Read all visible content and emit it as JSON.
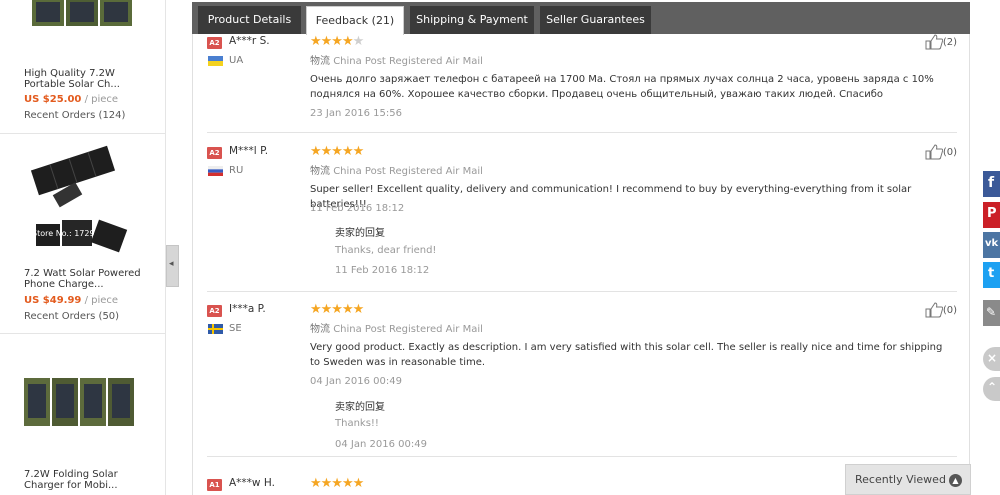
{
  "products": [
    {
      "title": "High Quality 7.2W Portable Solar Ch...",
      "price": "US $25.00",
      "unit": "/ piece",
      "orders": "Recent Orders (124)"
    },
    {
      "title": "7.2 Watt Solar Powered Phone Charge...",
      "price": "US $49.99",
      "unit": "/ piece",
      "orders": "Recent Orders (50)",
      "watermark": "Store No.: 1729"
    },
    {
      "title": "7.2W Folding Solar Charger for Mobi...",
      "price": "",
      "unit": "",
      "orders": ""
    }
  ],
  "tabs": [
    {
      "label": "Product Details",
      "active": false
    },
    {
      "label": "Feedback (21)",
      "active": true
    },
    {
      "label": "Shipping & Payment",
      "active": false
    },
    {
      "label": "Seller Guarantees",
      "active": false
    }
  ],
  "reviews": [
    {
      "badge": "A2",
      "badge_color": "#d9534f",
      "user": "A***r S.",
      "country": "UA",
      "flag": "ua",
      "rating": 4,
      "shipping_zh": "物流",
      "shipping": "China Post Registered Air Mail",
      "text": "Очень долго заряжает телефон с батареей на 1700 Ма. Стоял на прямых лучах солнца 2 часа, уровень заряда с 10% поднялся на 60%. Хорошее качество сборки. Продавец очень общительный, уважаю таких людей. Спасибо",
      "date": "23 Jan 2016 15:56",
      "likes": "(2)"
    },
    {
      "badge": "A2",
      "badge_color": "#d9534f",
      "user": "M***l P.",
      "country": "RU",
      "flag": "ru",
      "rating": 5,
      "shipping_zh": "物流",
      "shipping": "China Post Registered Air Mail",
      "text": "Super seller! Excellent quality, delivery and communication! I recommend to buy by everything-everything from it solar batteries!!!",
      "date": "11 Feb 2016 18:12",
      "likes": "(0)",
      "reply": {
        "title": "卖家的回复",
        "text": "Thanks, dear friend!",
        "date": "11 Feb 2016 18:12"
      }
    },
    {
      "badge": "A2",
      "badge_color": "#d9534f",
      "user": "I***a P.",
      "country": "SE",
      "flag": "se",
      "rating": 5,
      "shipping_zh": "物流",
      "shipping": "China Post Registered Air Mail",
      "text": "Very good product. Exactly as description. I am very satisfied with this solar cell. The seller is really nice and time for shipping to Sweden was in reasonable time.",
      "date": "04 Jan 2016 00:49",
      "likes": "(0)",
      "reply": {
        "title": "卖家的回复",
        "text": "Thanks!!",
        "date": "04 Jan 2016 00:49"
      }
    },
    {
      "badge": "A1",
      "badge_color": "#d9534f",
      "user": "A***w H.",
      "rating": 5
    }
  ],
  "share": [
    {
      "icon": "facebook-icon",
      "glyph": "f",
      "color": "#3b5998"
    },
    {
      "icon": "pinterest-icon",
      "glyph": "P",
      "color": "#cb2027"
    },
    {
      "icon": "vk-icon",
      "glyph": "vk",
      "color": "#4c75a3"
    },
    {
      "icon": "twitter-icon",
      "glyph": "t",
      "color": "#1da1f2"
    },
    {
      "icon": "edit-icon",
      "glyph": "✎",
      "color": "#8a8a8a"
    }
  ],
  "recently_viewed": "Recently Viewed"
}
